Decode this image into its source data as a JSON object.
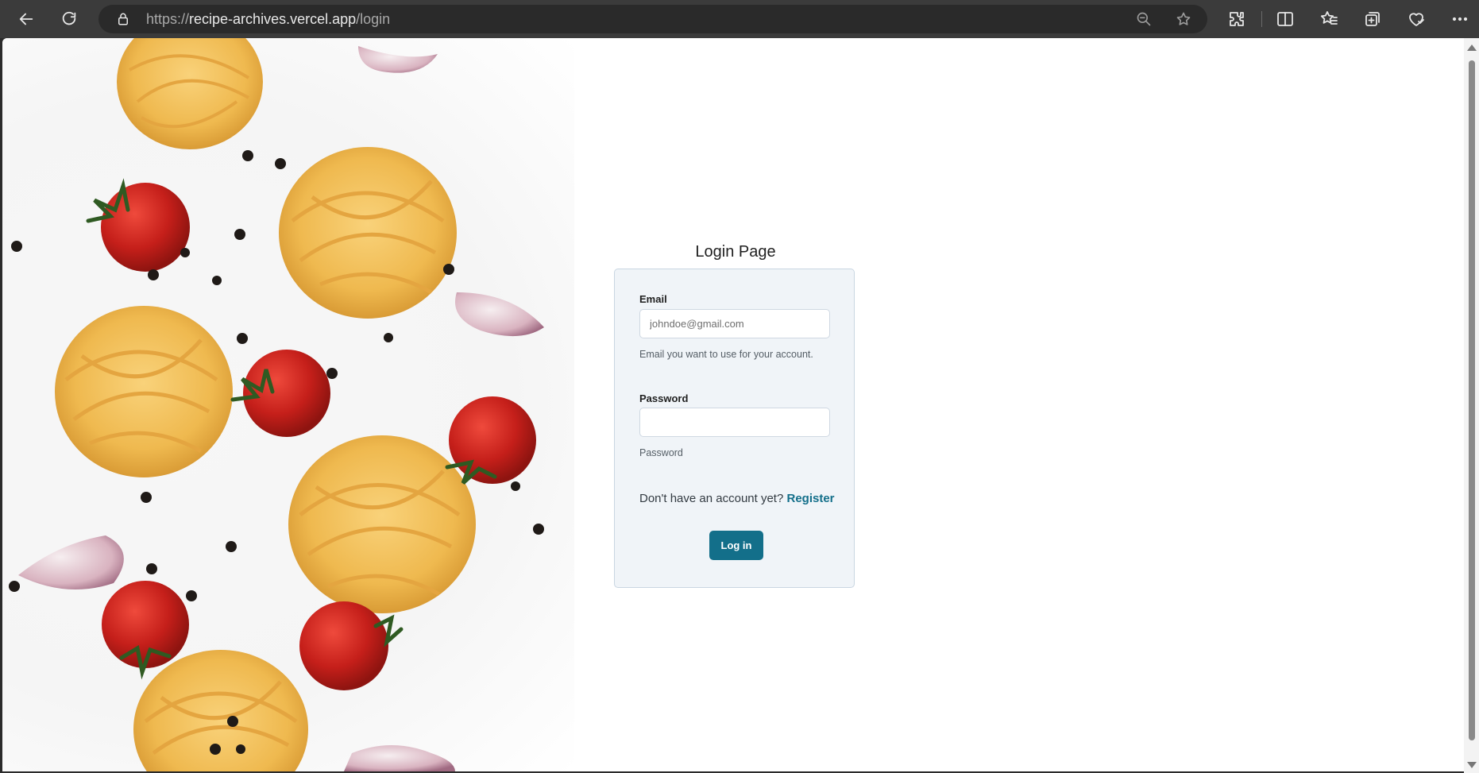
{
  "browser": {
    "url_prefix": "https://",
    "url_host": "recipe-archives.vercel.app",
    "url_path": "/login"
  },
  "login": {
    "title": "Login Page",
    "email_label": "Email",
    "email_placeholder": "johndoe@gmail.com",
    "email_hint": "Email you want to use for your account.",
    "password_label": "Password",
    "password_placeholder": "",
    "password_hint": "Password",
    "register_prompt": "Don't have an account yet?",
    "register_link": "Register",
    "submit_label": "Log in"
  },
  "colors": {
    "accent": "#136f8a",
    "card_bg": "#f0f4f8",
    "chrome_bg": "#3b3b3b"
  }
}
